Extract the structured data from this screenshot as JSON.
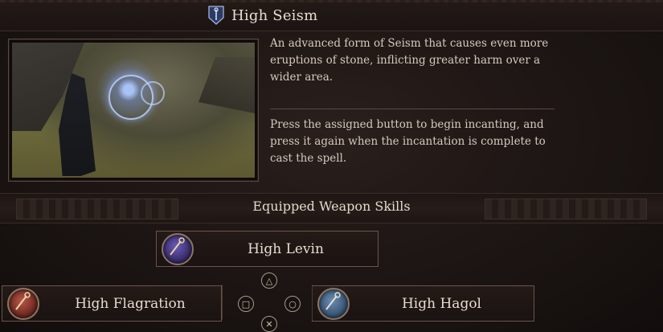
{
  "skill": {
    "name": "High Seism",
    "icon": "staff-badge-icon",
    "description_1": "An advanced form of Seism that causes even more eruptions of stone, inflicting greater harm over a wider area.",
    "description_2": "Press the assigned button to begin incanting, and press it again when the incantation is complete to cast the spell."
  },
  "equipped": {
    "heading": "Equipped Weapon Skills",
    "slots": [
      {
        "label": "High Levin",
        "icon": "levin-staff-icon"
      },
      {
        "label": "High Flagration",
        "icon": "flagration-staff-icon"
      },
      {
        "label": "High Hagol",
        "icon": "hagol-staff-icon"
      }
    ]
  },
  "buttons": {
    "triangle": "△",
    "square": "□",
    "circle": "○",
    "cross": "✕"
  }
}
